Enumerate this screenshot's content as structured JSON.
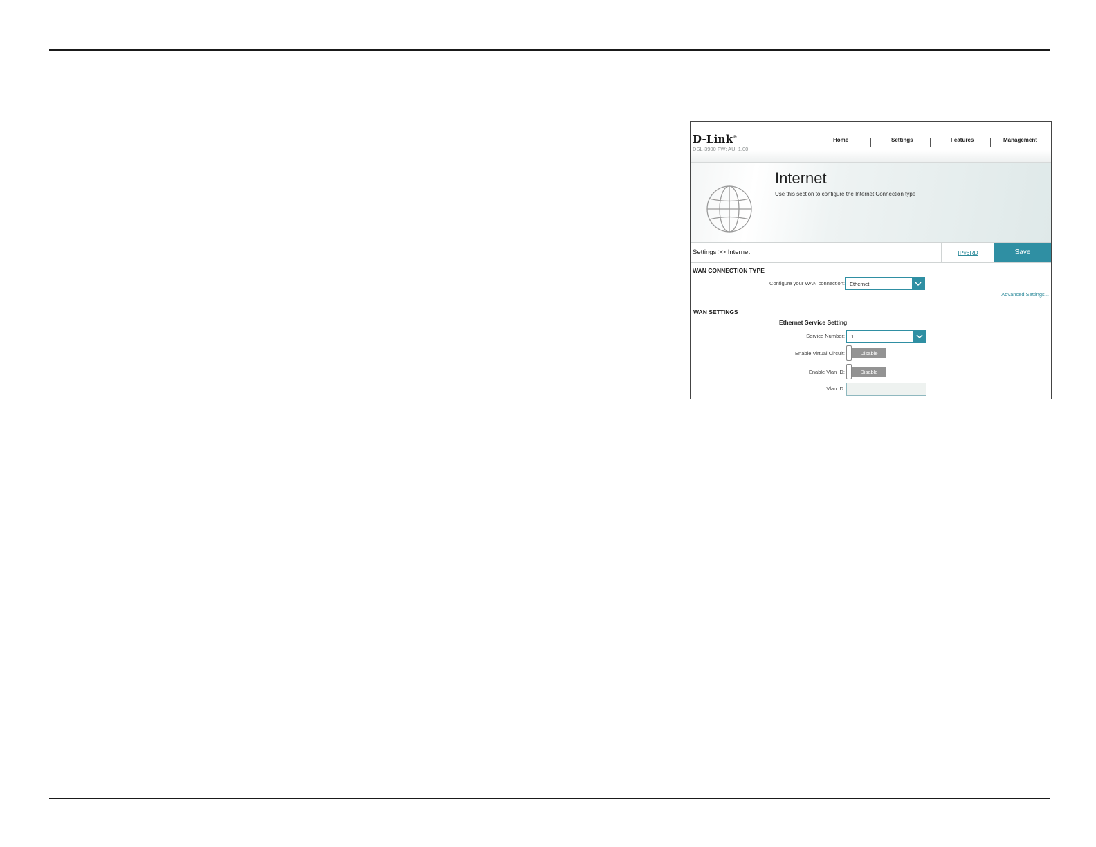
{
  "router": {
    "logo": "D-Link",
    "model": "DSL-3900   FW: AU_1.00",
    "nav": [
      "Home",
      "Settings",
      "Features",
      "Management"
    ],
    "banner": {
      "title": "Internet",
      "description": "Use this section to configure the Internet Connection type"
    },
    "breadcrumb": "Settings >> Internet",
    "ipv6_link": "IPv6RD",
    "save_label": "Save",
    "wan_connection": {
      "title": "WAN CONNECTION TYPE",
      "label": "Configure your WAN connection:",
      "value": "Ethernet",
      "advanced_link": "Advanced Settings..."
    },
    "wan_settings": {
      "title": "WAN SETTINGS",
      "subtitle": "Ethernet Service Setting",
      "service_number_label": "Service Number:",
      "service_number_value": "1",
      "virtual_circuit_label": "Enable Virtual Circuit:",
      "virtual_circuit_state": "Disable",
      "vlan_id_enable_label": "Enable Vlan ID:",
      "vlan_id_enable_state": "Disable",
      "vlan_id_label": "Vlan ID:",
      "vlan_id_value": ""
    },
    "colors": {
      "accent": "#2f8fa3",
      "toggle_off": "#939393"
    }
  }
}
